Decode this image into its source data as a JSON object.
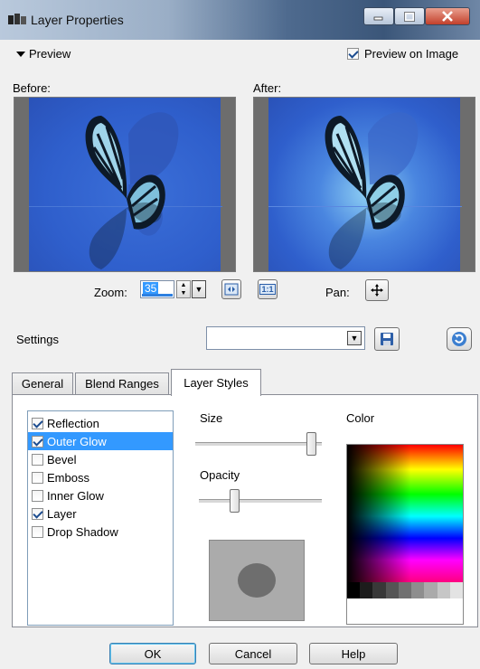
{
  "window": {
    "title": "Layer Properties",
    "icons": {
      "app": "layer-app-icon",
      "minimize": "minimize-icon",
      "maximize": "maximize-icon",
      "close": "close-icon"
    }
  },
  "preview": {
    "toggle_label": "Preview",
    "preview_on_image_label": "Preview on Image",
    "preview_on_image_checked": true,
    "before_label": "Before:",
    "after_label": "After:",
    "zoom_label": "Zoom:",
    "zoom_value": "35",
    "pan_label": "Pan:",
    "one_to_one_label": "1:1"
  },
  "settings": {
    "label": "Settings",
    "value": ""
  },
  "tabs": [
    {
      "label": "General",
      "active": false
    },
    {
      "label": "Blend Ranges",
      "active": false
    },
    {
      "label": "Layer Styles",
      "active": true
    }
  ],
  "layer_styles": {
    "effects": [
      {
        "label": "Reflection",
        "checked": true,
        "selected": false
      },
      {
        "label": "Outer Glow",
        "checked": true,
        "selected": true
      },
      {
        "label": "Bevel",
        "checked": false,
        "selected": false
      },
      {
        "label": "Emboss",
        "checked": false,
        "selected": false
      },
      {
        "label": "Inner Glow",
        "checked": false,
        "selected": false
      },
      {
        "label": "Layer",
        "checked": true,
        "selected": false
      },
      {
        "label": "Drop Shadow",
        "checked": false,
        "selected": false
      }
    ],
    "size_label": "Size",
    "size_level": 0.95,
    "opacity_label": "Opacity",
    "opacity_level": 0.27,
    "color_label": "Color"
  },
  "buttons": {
    "ok": "OK",
    "cancel": "Cancel",
    "help": "Help"
  },
  "colors": {
    "preview_blue": "#2f5fd0",
    "selection": "#3399ff"
  }
}
